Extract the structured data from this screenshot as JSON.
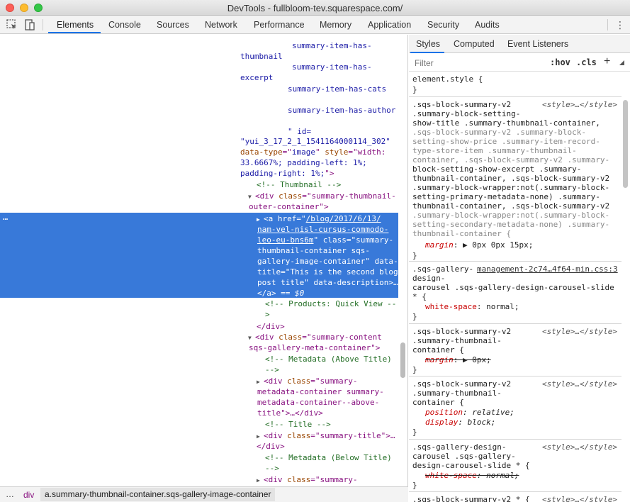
{
  "window": {
    "title": "DevTools - fullbloom-tev.squarespace.com/"
  },
  "toolbar": {
    "tabs": [
      "Elements",
      "Console",
      "Sources",
      "Network",
      "Performance",
      "Memory",
      "Application",
      "Security",
      "Audits"
    ],
    "active_tab": "Elements",
    "more_icon": "⋮"
  },
  "elements": {
    "lines": {
      "l1": "summary-item-has-",
      "l2": "thumbnail",
      "l3": "summary-item-has-",
      "l4": "excerpt",
      "l5": "summary-item-has-cats",
      "l6": "summary-item-has-author",
      "l7a": "\" id=",
      "l8": "\"yui_3_17_2_1_1541164000114_302\"",
      "l9a": "data-type",
      "l9b": "=\"",
      "l9c": "image",
      "l9d": "\" ",
      "l9e": "style",
      "l9f": "=\"width:",
      "l10": "33.6667%; padding-left: 1%;",
      "l11a": "padding-right: 1%;",
      "l11b": "\">",
      "l12": "<!-- Thumbnail -->",
      "l13a": "<div ",
      "l13b": "class",
      "l13c": "=\"summary-thumbnail-",
      "l14a": "outer-container",
      "l14b": "\">",
      "s1a": "<a ",
      "s1b": "href",
      "s1c": "=\"",
      "s1d": "/blog/2017/6/13/",
      "s2": "nam-vel-nisl-cursus-commodo-",
      "s3a": "leo-eu-bns6m",
      "s3b": "\" class=\"summary-",
      "s4": "thumbnail-container sqs-",
      "s5": "gallery-image-container\" data-",
      "s6": "title=\"This is the second blog",
      "s7": "post title\" data-description>…",
      "s8a": "</a>",
      "s8b": " == $0",
      "l15": "<!-- Products: Quick View --",
      "l16": ">",
      "l17": "</div>",
      "l18a": "<div ",
      "l18b": "class",
      "l18c": "=\"summary-content",
      "l19": "sqs-gallery-meta-container\">",
      "l20": "<!-- Metadata (Above Title)",
      "l21": "-->",
      "l22a": "<div ",
      "l22b": "class",
      "l22c": "=\"summary-",
      "l23": "metadata-container summary-",
      "l24": "metadata-container--above-",
      "l25a": "title",
      "l25b": "\">…</div>",
      "l26": "<!-- Title -->",
      "l27a": "<div ",
      "l27b": "class",
      "l27c": "=\"summary-title\">…",
      "l28": "</div>",
      "l29": "<!-- Metadata (Below Title)",
      "l30": "-->",
      "l31a": "<div ",
      "l31b": "class",
      "l31c": "=\"summary-"
    },
    "ellipsis": "…"
  },
  "styles": {
    "tabs": [
      "Styles",
      "Computed",
      "Event Listeners"
    ],
    "active_tab": "Styles",
    "filter_placeholder": "Filter",
    "hov": ":hov",
    "cls": ".cls",
    "plus": "+",
    "r0": {
      "sel": "element.style {",
      "close": "}"
    },
    "r1": {
      "source": "<style>…</style>",
      "s1": ".sqs-block-summary-v2",
      "s2": ".summary-block-setting-",
      "s3": "show-title .summary-thumbnail-container,",
      "s4": ".sqs-block-summary-v2 .summary-block-",
      "s5": "setting-show-price .summary-item-record-",
      "s6": "type-store-item .summary-thumbnail-",
      "s7": "container, .sqs-block-summary-v2 .summary-",
      "s8": "block-setting-show-excerpt .summary-",
      "s9": "thumbnail-container, .sqs-block-summary-v2",
      "s10": ".summary-block-wrapper:not(.summary-block-",
      "s11": "setting-primary-metadata-none) .summary-",
      "s12": "thumbnail-container, .sqs-block-summary-v2",
      "s13": ".summary-block-wrapper:not(.summary-block-",
      "s14": "setting-secondary-metadata-none) .summary-",
      "s15": "thumbnail-container {",
      "p1n": "margin",
      "p1v": ": ▶ 0px 0px 15px;",
      "close": "}"
    },
    "r2": {
      "source": "management-2c74…4f64-min.css:3",
      "s1": ".sqs-gallery-",
      "s2": "design-",
      "s3": "carousel .sqs-gallery-design-carousel-slide",
      "s4": "* {",
      "p1n": "white-space",
      "p1v": ": normal;",
      "close": "}"
    },
    "r3": {
      "source": "<style>…</style>",
      "s1": ".sqs-block-summary-v2",
      "s2": ".summary-thumbnail-",
      "s3": "container {",
      "p1n": "margin",
      "p1v": ": ▶ 0px;",
      "close": "}"
    },
    "r4": {
      "source": "<style>…</style>",
      "s1": ".sqs-block-summary-v2",
      "s2": ".summary-thumbnail-",
      "s3": "container {",
      "p1n": "position",
      "p1v": ": relative;",
      "p2n": "display",
      "p2v": ": block;",
      "close": "}"
    },
    "r5": {
      "source": "<style>…</style>",
      "s1": ".sqs-gallery-design-",
      "s2": "carousel .sqs-gallery-",
      "s3": "design-carousel-slide * {",
      "p1n": "white-space",
      "p1v": ": normal;",
      "close": "}"
    },
    "r6": {
      "source": "<style>…</style>",
      "s1": ".sqs-block-summary-v2 * {"
    }
  },
  "breadcrumb": {
    "dots": "…",
    "div": "div",
    "current": "a.summary-thumbnail-container.sqs-gallery-image-container"
  }
}
